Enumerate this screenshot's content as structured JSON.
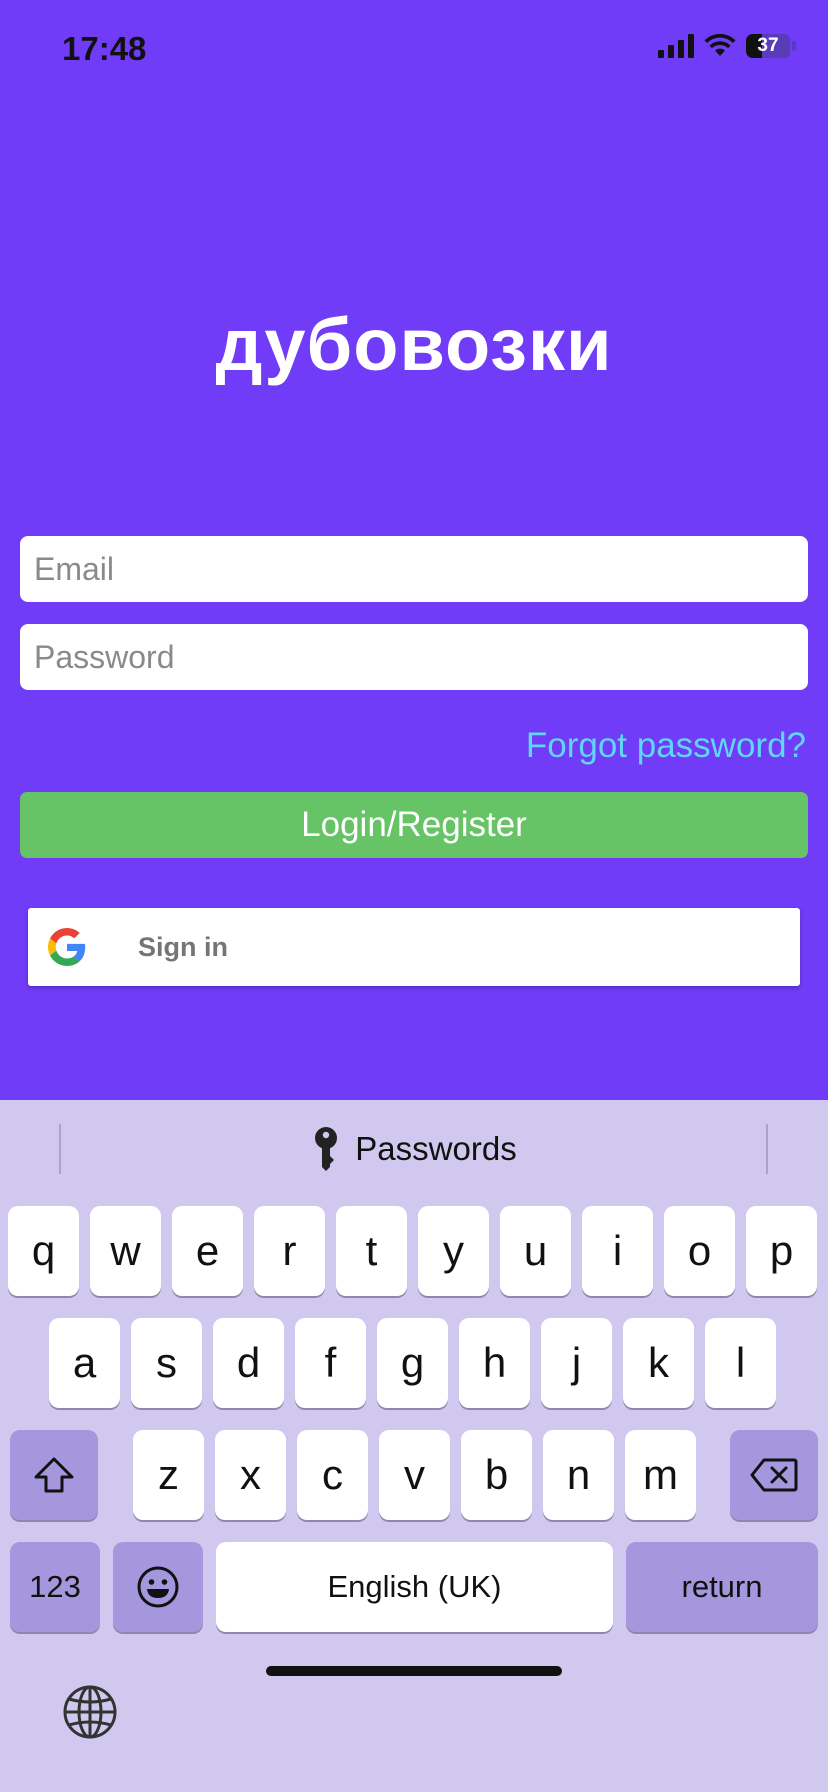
{
  "status_bar": {
    "time": "17:48",
    "battery": "37",
    "battery_level": 0.37
  },
  "app": {
    "title": "дубовозки",
    "email_placeholder": "Email",
    "password_placeholder": "Password",
    "forgot_label": "Forgot password?",
    "login_label": "Login/Register",
    "google_label": "Sign in"
  },
  "colors": {
    "background": "#703cf7",
    "login_button": "#66c466",
    "forgot_link": "#5fd6f5",
    "keyboard_bg": "#d0c8ef",
    "special_key": "#a597dd"
  },
  "keyboard": {
    "suggestion_label": "Passwords",
    "row1": [
      "q",
      "w",
      "e",
      "r",
      "t",
      "y",
      "u",
      "i",
      "o",
      "p"
    ],
    "row2": [
      "a",
      "s",
      "d",
      "f",
      "g",
      "h",
      "j",
      "k",
      "l"
    ],
    "row3": [
      "z",
      "x",
      "c",
      "v",
      "b",
      "n",
      "m"
    ],
    "numbers_label": "123",
    "space_label": "English (UK)",
    "return_label": "return",
    "icons": {
      "shift": "shift-icon",
      "delete": "delete-icon",
      "emoji": "emoji-icon",
      "globe": "globe-icon",
      "key": "key-icon"
    }
  }
}
